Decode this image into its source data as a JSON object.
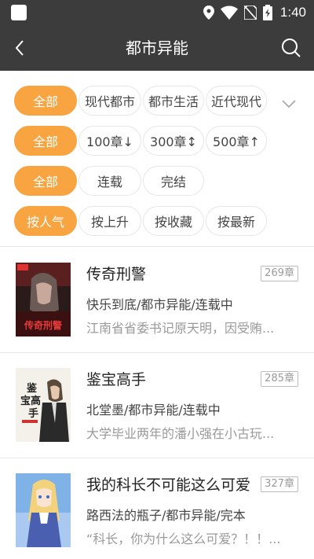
{
  "status_bar": {
    "time": "1:40"
  },
  "header": {
    "title": "都市异能"
  },
  "filters": {
    "categories": [
      "全部",
      "现代都市",
      "都市生活",
      "近代现代"
    ],
    "lengths": [
      "全部",
      "100章↓",
      "300章↕",
      "500章↑"
    ],
    "status": [
      "全部",
      "连载",
      "完结"
    ],
    "sort": [
      "按人气",
      "按上升",
      "按收藏",
      "按最新"
    ]
  },
  "books": [
    {
      "title": "传奇刑警",
      "chapters": "269章",
      "meta": "快乐到底/都市异能/连载中",
      "desc": "江南省省委书记原天明，因受贿...",
      "cover_text": "传奇刑警"
    },
    {
      "title": "鉴宝高手",
      "chapters": "285章",
      "meta": "北堂墨/都市异能/连载中",
      "desc": "大学毕业两年的潘小强在小古玩...",
      "cover_text": "鉴宝高手"
    },
    {
      "title": "我的科长不可能这么可爱",
      "chapters": "327章",
      "meta": "路西法的瓶子/都市异能/完本",
      "desc": "“科长，你为什么这么可爱？！！...",
      "cover_text": ""
    }
  ],
  "colors": {
    "accent": "#f7a441",
    "header_bg": "#3c3c3c"
  }
}
